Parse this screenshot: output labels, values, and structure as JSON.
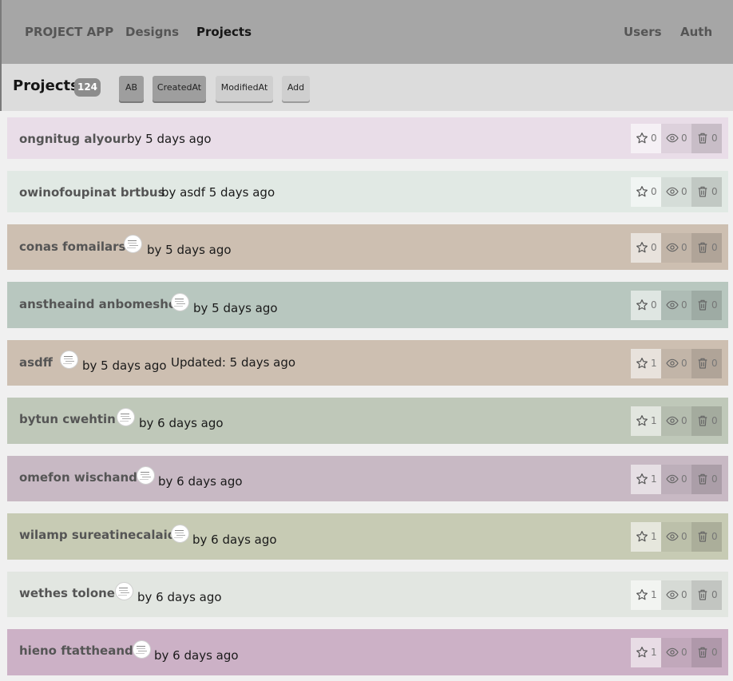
{
  "nav": {
    "brand": "PROJECT APP",
    "designs": "Designs",
    "projects": "Projects",
    "users": "Users",
    "auth": "Auth"
  },
  "toolbar": {
    "title": "Projects",
    "count": "124",
    "ab": "AB",
    "created_at": "CreatedAt",
    "modified_at": "ModifiedAt",
    "add": "Add"
  },
  "colors": {
    "row_0": "#e9dde8",
    "row_1": "#e1e9e4",
    "row_2": "#cdbfb1",
    "row_3": "#b8c7bf",
    "row_4": "#cdbfb1",
    "row_5": "#bfc8b9",
    "row_6": "#c8b9c4",
    "row_7": "#c7cbb4",
    "row_8": "#e2e6e1",
    "row_9": "#ccb1c6"
  },
  "rows": [
    {
      "title": "ongnitug alyour",
      "by": "by 5 days ago",
      "stars": "0",
      "views": "0",
      "deletes": "0"
    },
    {
      "title": "owinofoupinat brtbus",
      "by": "by asdf 5 days ago",
      "stars": "0",
      "views": "0",
      "deletes": "0"
    },
    {
      "title": "conas fomailars",
      "by": "by 5 days ago",
      "stars": "0",
      "views": "0",
      "deletes": "0"
    },
    {
      "title": "anstheaind anbomesho",
      "by": "by 5 days ago",
      "stars": "0",
      "views": "0",
      "deletes": "0"
    },
    {
      "title": "asdff",
      "by": "by 5 days ago",
      "updated": "Updated: 5 days ago",
      "stars": "1",
      "views": "0",
      "deletes": "0"
    },
    {
      "title": "bytun cwehtin",
      "by": "by 6 days ago",
      "stars": "1",
      "views": "0",
      "deletes": "0"
    },
    {
      "title": "omefon wischand",
      "by": "by 6 days ago",
      "stars": "1",
      "views": "0",
      "deletes": "0"
    },
    {
      "title": "wilamp sureatinecalaid",
      "by": "by 6 days ago",
      "stars": "1",
      "views": "0",
      "deletes": "0"
    },
    {
      "title": "wethes tolone",
      "by": "by 6 days ago",
      "stars": "1",
      "views": "0",
      "deletes": "0"
    },
    {
      "title": "hieno ftattheand",
      "by": "by 6 days ago",
      "stars": "1",
      "views": "0",
      "deletes": "0"
    }
  ]
}
